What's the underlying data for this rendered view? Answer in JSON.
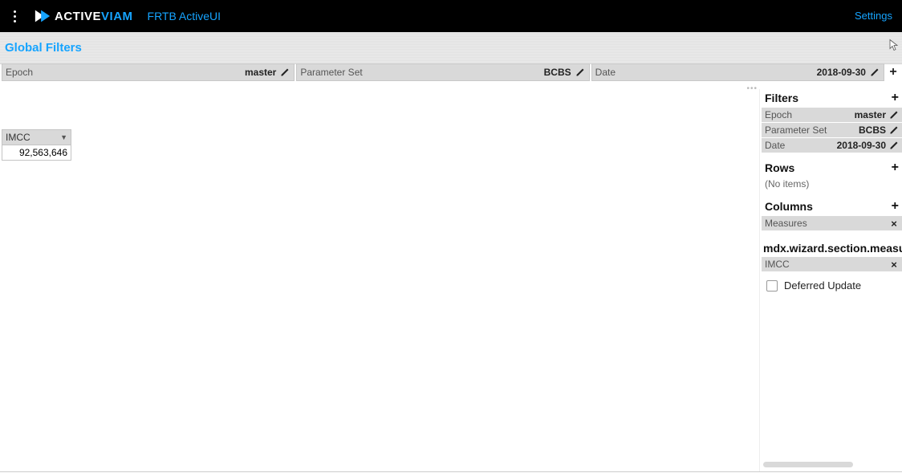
{
  "topbar": {
    "brand_prefix": "ACTIVE",
    "brand_suffix": "VIAM",
    "product": "FRTB ActiveUI",
    "settings": "Settings"
  },
  "global_filters": {
    "title": "Global Filters",
    "pills": [
      {
        "label": "Epoch",
        "value": "master"
      },
      {
        "label": "Parameter Set",
        "value": "BCBS"
      },
      {
        "label": "Date",
        "value": "2018-09-30"
      }
    ]
  },
  "table": {
    "header": "IMCC",
    "value": "92,563,646"
  },
  "side": {
    "filters": {
      "title": "Filters",
      "items": [
        {
          "label": "Epoch",
          "value": "master"
        },
        {
          "label": "Parameter Set",
          "value": "BCBS"
        },
        {
          "label": "Date",
          "value": "2018-09-30"
        }
      ]
    },
    "rows": {
      "title": "Rows",
      "empty": "(No items)"
    },
    "columns": {
      "title": "Columns",
      "items": [
        {
          "label": "Measures"
        }
      ]
    },
    "measures": {
      "title": "mdx.wizard.section.measures",
      "items": [
        {
          "label": "IMCC"
        }
      ]
    },
    "deferred": "Deferred Update"
  }
}
